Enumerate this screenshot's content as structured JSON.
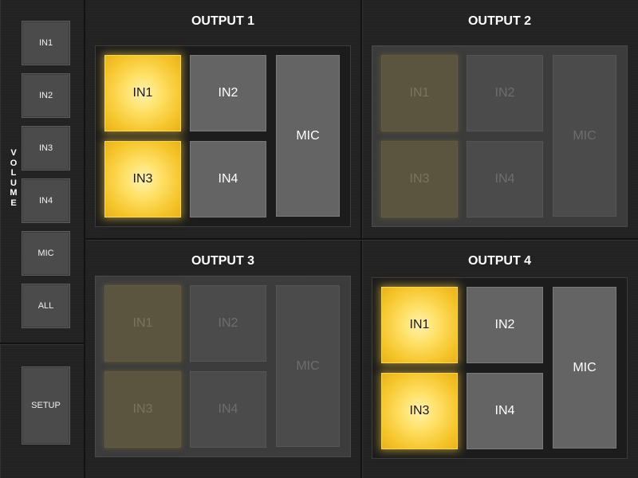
{
  "sidebar": {
    "volume_label": [
      "V",
      "O",
      "L",
      "U",
      "M",
      "E"
    ],
    "buttons": [
      {
        "label": "IN1"
      },
      {
        "label": "IN2"
      },
      {
        "label": "IN3"
      },
      {
        "label": "IN4"
      },
      {
        "label": "MIC"
      },
      {
        "label": "ALL"
      }
    ],
    "setup_label": "SETUP"
  },
  "outputs": [
    {
      "title": "OUTPUT 1",
      "dimmed": false,
      "cells": [
        {
          "label": "IN1",
          "active": true
        },
        {
          "label": "IN2",
          "active": false
        },
        {
          "label": "IN3",
          "active": true
        },
        {
          "label": "IN4",
          "active": false
        },
        {
          "label": "MIC",
          "active": false
        }
      ]
    },
    {
      "title": "OUTPUT 2",
      "dimmed": true,
      "cells": [
        {
          "label": "IN1",
          "active": true
        },
        {
          "label": "IN2",
          "active": false
        },
        {
          "label": "IN3",
          "active": true
        },
        {
          "label": "IN4",
          "active": false
        },
        {
          "label": "MIC",
          "active": false
        }
      ]
    },
    {
      "title": "OUTPUT 3",
      "dimmed": true,
      "cells": [
        {
          "label": "IN1",
          "active": true
        },
        {
          "label": "IN2",
          "active": false
        },
        {
          "label": "IN3",
          "active": true
        },
        {
          "label": "IN4",
          "active": false
        },
        {
          "label": "MIC",
          "active": false
        }
      ]
    },
    {
      "title": "OUTPUT 4",
      "dimmed": false,
      "cells": [
        {
          "label": "IN1",
          "active": true
        },
        {
          "label": "IN2",
          "active": false
        },
        {
          "label": "IN3",
          "active": true
        },
        {
          "label": "IN4",
          "active": false
        },
        {
          "label": "MIC",
          "active": false
        }
      ]
    }
  ],
  "colors": {
    "active": "#f5c42a",
    "inactive": "#646464",
    "background": "#222222"
  }
}
